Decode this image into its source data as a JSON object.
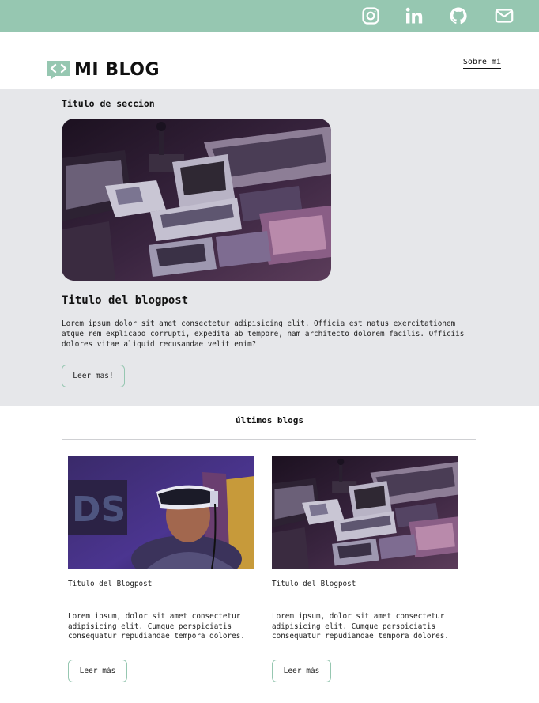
{
  "social": [
    {
      "name": "instagram-icon"
    },
    {
      "name": "linkedin-icon"
    },
    {
      "name": "github-icon"
    },
    {
      "name": "email-icon"
    }
  ],
  "header": {
    "logo_text": "MI BLOG",
    "logo_icon": "code-chat-icon",
    "about_label": "Sobre mi"
  },
  "featured": {
    "section_title": "Titulo de seccion",
    "post_title": "Titulo del blogpost",
    "description": "Lorem ipsum dolor sit amet consectetur adipisicing elit. Officia est natus exercitationem atque rem explicabo corrupti, expedita ab tempore, nam architecto dolorem facilis. Officiis dolores vitae aliquid recusandae velit enim?",
    "button_label": "Leer mas!"
  },
  "latest": {
    "heading": "últimos blogs",
    "cards": [
      {
        "title": "Titulo del Blogpost",
        "description": "Lorem ipsum, dolor sit amet consectetur adipisicing elit. Cumque perspiciatis consequatur repudiandae tempora dolores.",
        "button_label": "Leer más"
      },
      {
        "title": "Titulo del Blogpost",
        "description": "Lorem ipsum, dolor sit amet consectetur adipisicing elit. Cumque perspiciatis consequatur repudiandae tempora dolores.",
        "button_label": "Leer más"
      }
    ]
  },
  "colors": {
    "accent": "#96c7b1",
    "featured_bg": "#e6e7ea",
    "text": "#111111"
  }
}
